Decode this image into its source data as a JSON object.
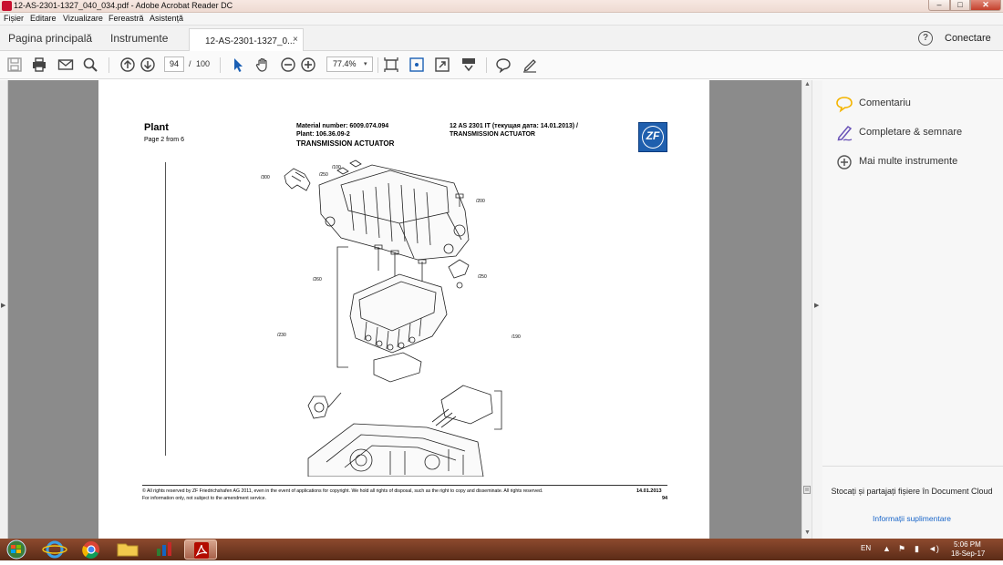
{
  "window": {
    "title": "12-AS-2301-1327_040_034.pdf - Adobe Acrobat Reader DC",
    "controls": {
      "minimize": "–",
      "maximize": "□",
      "close": "✕"
    }
  },
  "menu": {
    "items": [
      "Fișier",
      "Editare",
      "Vizualizare",
      "Fereastră",
      "Asistență"
    ]
  },
  "tabs": {
    "home": "Pagina principală",
    "tools": "Instrumente",
    "document": "12-AS-2301-1327_0...",
    "document_close": "×",
    "help": "?",
    "sign_in": "Conectare"
  },
  "toolbar": {
    "icons": [
      "save-icon",
      "print-icon",
      "email-icon",
      "search-icon",
      "page-up-icon",
      "page-down-icon",
      "select-cursor-icon",
      "hand-tool-icon",
      "zoom-out-icon",
      "zoom-in-icon",
      "fit-width-icon",
      "fit-page-icon",
      "fullscreen-icon",
      "read-mode-icon",
      "comment-icon",
      "sign-icon"
    ],
    "page_current": "94",
    "page_separator": "/",
    "page_total": "100",
    "zoom": "77.4%",
    "zoom_dropdown": "▾"
  },
  "right_pane": {
    "tools": [
      {
        "label": "Comentariu",
        "icon": "comment-icon",
        "color": "#f4b400"
      },
      {
        "label": "Completare & semnare",
        "icon": "fill-sign-icon",
        "color": "#6b54b8"
      },
      {
        "label": "Mai multe instrumente",
        "icon": "more-tools-icon",
        "color": "#555555"
      }
    ],
    "cloud_text": "Stocați și partajați fișiere în Document Cloud",
    "learn_more": "Informații suplimentare"
  },
  "scroll": {
    "left_arrow": "◀",
    "right_arrow": "▶",
    "up_arrow": "▲",
    "down_arrow": "▼"
  },
  "pdf": {
    "title": "Plant",
    "subtitle": "Page 2 from 6",
    "material": "Material number: 6009.074.094",
    "plant": "Plant: 106.36.09-2",
    "assembly": "TRANSMISSION ACTUATOR",
    "model": "12 AS 2301 IT (текущая дата: 14.01.2013) /",
    "model_line2": "TRANSMISSION ACTUATOR",
    "logo_text": "ZF",
    "callouts": [
      "/300",
      "/100",
      "/250",
      "/200",
      "/260",
      "/250",
      "/230",
      "/190"
    ],
    "footer_copyright": "© All rights reserved by ZF Friedrichshafen AG 2011, even in the event of applications for copyright. We hold all rights of disposal, such as the right to copy and disseminate. All rights reserved.",
    "footer_date": "14.01.2013",
    "footer_info": "For information only, not subject to the amendment service.",
    "footer_page": "94"
  },
  "taskbar": {
    "apps": [
      "start-orb",
      "ie-icon",
      "chrome-icon",
      "explorer-icon",
      "office-icon",
      "acrobat-reader-icon"
    ],
    "lang": "EN",
    "tray": [
      "▲",
      "⚑",
      "▮",
      "◄)"
    ],
    "time": "5:06 PM",
    "date": "18-Sep-17"
  }
}
